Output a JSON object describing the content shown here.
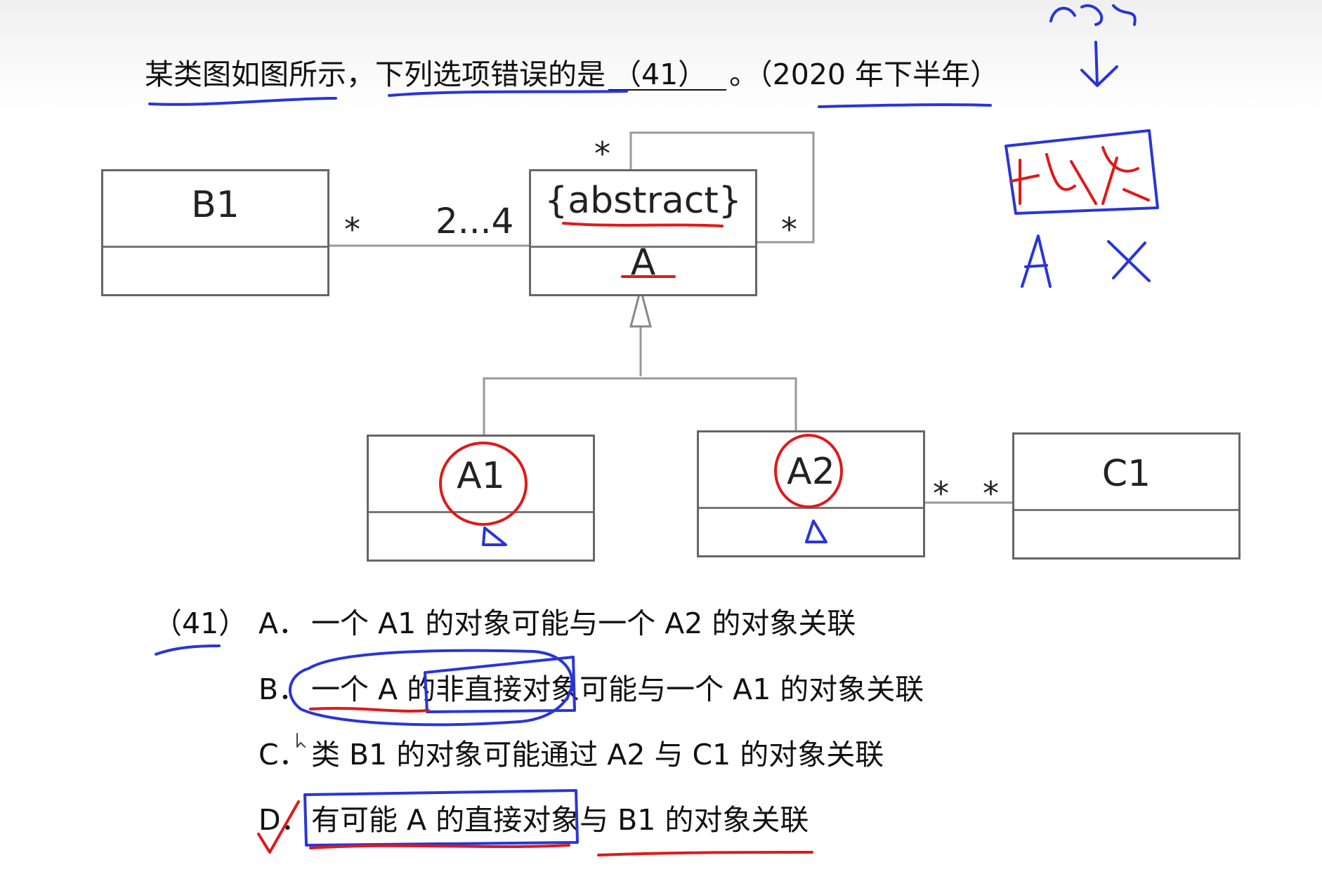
{
  "question": {
    "stem": "某类图如图所示，下列选项错误的是",
    "blank": "（41）",
    "end": "。（2020 年下半年）"
  },
  "diagram": {
    "classes": {
      "b1": "B1",
      "a_stereotype": "{abstract}",
      "a": "A",
      "a1": "A1",
      "a2": "A2",
      "c1": "C1"
    },
    "multiplicities": {
      "b1_end": "*",
      "a_end": "2...4",
      "self_top": "*",
      "self_right": "*",
      "a2_end": "*",
      "c1_end": "*"
    }
  },
  "options": {
    "number": "（41）",
    "a": {
      "label": "A．",
      "text": "一个 A1 的对象可能与一个 A2 的对象关联"
    },
    "b": {
      "label": "B．",
      "text": "一个 A 的非直接对象可能与一个 A1 的对象关联"
    },
    "c": {
      "label": "C．",
      "text": "类 B1 的对象可能通过 A2 与 C1 的对象关联"
    },
    "d": {
      "label": "D．",
      "text": "有可能 A 的直接对象与 B1 的对象关联"
    }
  },
  "colors": {
    "ink_blue": "#2a35d6",
    "ink_red": "#e01919",
    "uml_border": "#666666"
  }
}
